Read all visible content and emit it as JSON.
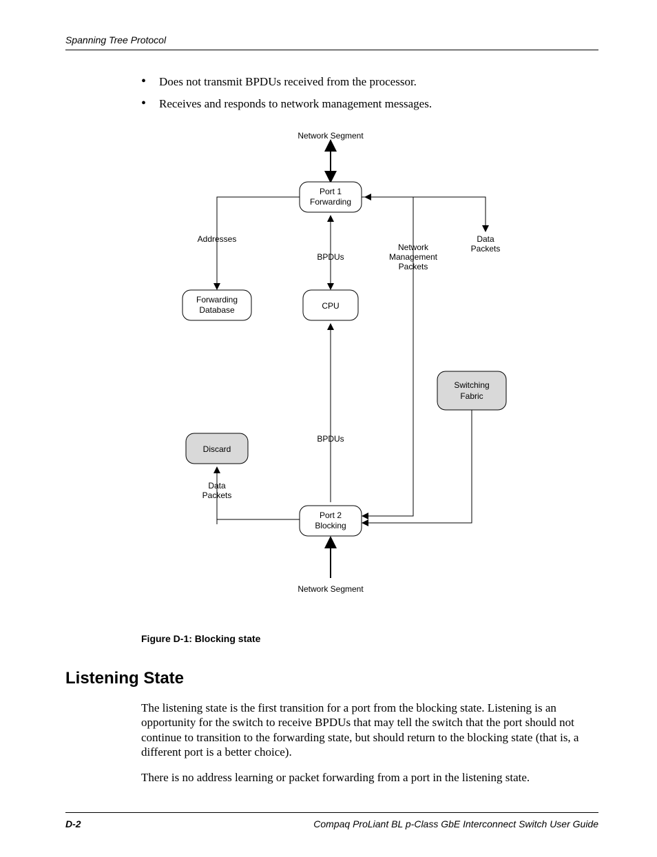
{
  "header": {
    "title": "Spanning Tree Protocol"
  },
  "bullets": [
    "Does not transmit BPDUs received from the processor.",
    "Receives and responds to network management messages."
  ],
  "diagram": {
    "top_segment": "Network Segment",
    "port1": {
      "l1": "Port 1",
      "l2": "Forwarding"
    },
    "addresses": "Addresses",
    "bpdus_top": "BPDUs",
    "nmp": {
      "l1": "Network",
      "l2": "Management",
      "l3": "Packets"
    },
    "data_packets_r": {
      "l1": "Data",
      "l2": "Packets"
    },
    "fwd_db": {
      "l1": "Forwarding",
      "l2": "Database"
    },
    "cpu": "CPU",
    "switching": {
      "l1": "Switching",
      "l2": "Fabric"
    },
    "discard": "Discard",
    "bpdus_bottom": "BPDUs",
    "data_packets_l": {
      "l1": "Data",
      "l2": "Packets"
    },
    "port2": {
      "l1": "Port 2",
      "l2": "Blocking"
    },
    "bottom_segment": "Network Segment"
  },
  "caption": "Figure D-1:  Blocking state",
  "section_title": "Listening State",
  "para1": "The listening state is the first transition for a port from the blocking state. Listening is an opportunity for the switch to receive BPDUs that may tell the switch that the port should not continue to transition to the forwarding state, but should return to the blocking state (that is, a different port is a better choice).",
  "para2": "There is no address learning or packet forwarding from a port in the listening state.",
  "footer": {
    "page": "D-2",
    "doc": "Compaq ProLiant BL p-Class GbE Interconnect Switch User Guide"
  }
}
